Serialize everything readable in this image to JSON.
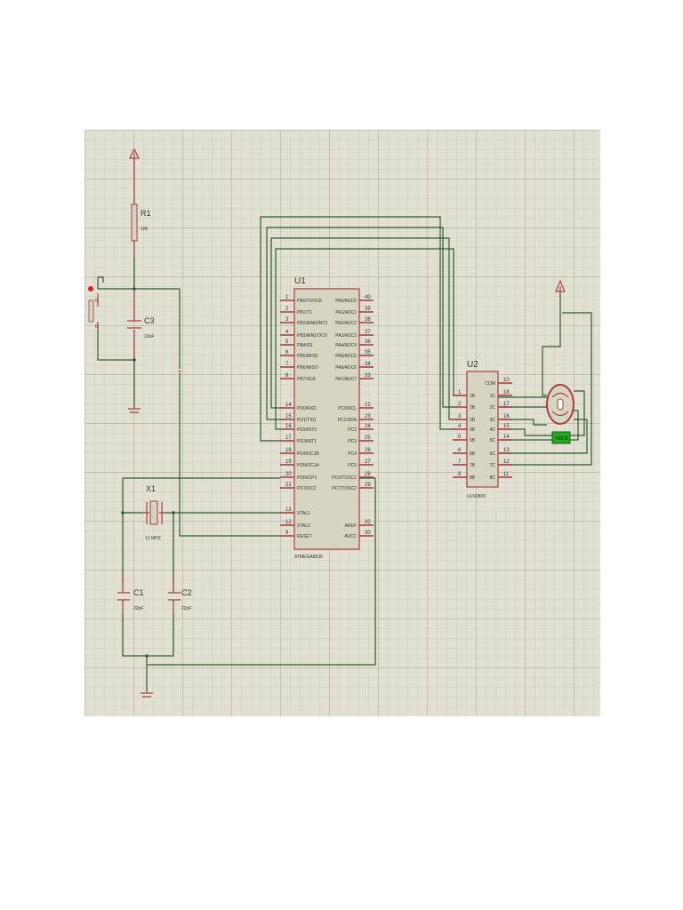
{
  "colors": {
    "grid_bg": "#e2e0d3",
    "wire": "#2f5a2f",
    "component": "#a84040",
    "body": "#d8d4c2"
  },
  "components": {
    "r1": {
      "ref": "R1",
      "value": "10k"
    },
    "c3": {
      "ref": "C3",
      "value": "10uF"
    },
    "x1": {
      "ref": "X1",
      "value": "12 MHZ"
    },
    "c1": {
      "ref": "C1",
      "value": "22pF"
    },
    "c2": {
      "ref": "C2",
      "value": "22pF"
    },
    "switch_contacts": [
      "0",
      "0"
    ],
    "motor_readout": "+88.8"
  },
  "u1": {
    "ref": "U1",
    "part": "ATMEGA8535",
    "left_pins": [
      {
        "num": "1",
        "name": "PB0/T0/XCK"
      },
      {
        "num": "2",
        "name": "PB1/T1"
      },
      {
        "num": "3",
        "name": "PB2/AIN0/INT2"
      },
      {
        "num": "4",
        "name": "PB3/AIN1/OC0"
      },
      {
        "num": "5",
        "name": "PB4/SS"
      },
      {
        "num": "6",
        "name": "PB5/MOSI"
      },
      {
        "num": "7",
        "name": "PB6/MISO"
      },
      {
        "num": "8",
        "name": "PB7/SCK"
      },
      {
        "num": "14",
        "name": "PD0/RXD"
      },
      {
        "num": "15",
        "name": "PD1/TXD"
      },
      {
        "num": "16",
        "name": "PD2/INT0"
      },
      {
        "num": "17",
        "name": "PD3/INT1"
      },
      {
        "num": "18",
        "name": "PD4/OC1B"
      },
      {
        "num": "19",
        "name": "PD5/OC1A"
      },
      {
        "num": "20",
        "name": "PD6/ICP1"
      },
      {
        "num": "21",
        "name": "PD7/OC2"
      },
      {
        "num": "13",
        "name": "XTAL1"
      },
      {
        "num": "12",
        "name": "XTAL2"
      },
      {
        "num": "9",
        "name": "RESET"
      }
    ],
    "right_pins": [
      {
        "num": "40",
        "name": "PA0/ADC0"
      },
      {
        "num": "39",
        "name": "PA1/ADC1"
      },
      {
        "num": "38",
        "name": "PA2/ADC2"
      },
      {
        "num": "37",
        "name": "PA3/ADC3"
      },
      {
        "num": "36",
        "name": "PA4/ADC4"
      },
      {
        "num": "35",
        "name": "PA5/ADC5"
      },
      {
        "num": "34",
        "name": "PA6/ADC6"
      },
      {
        "num": "33",
        "name": "PA7/ADC7"
      },
      {
        "num": "22",
        "name": "PC0/SCL"
      },
      {
        "num": "23",
        "name": "PC1/SDA"
      },
      {
        "num": "24",
        "name": "PC2"
      },
      {
        "num": "25",
        "name": "PC3"
      },
      {
        "num": "26",
        "name": "PC4"
      },
      {
        "num": "27",
        "name": "PC5"
      },
      {
        "num": "28",
        "name": "PC6/TOSC1"
      },
      {
        "num": "29",
        "name": "PC7/TOSC2"
      },
      {
        "num": "32",
        "name": "AREF"
      },
      {
        "num": "30",
        "name": "AVCC"
      }
    ]
  },
  "u2": {
    "ref": "U2",
    "part": "ULN2803",
    "left_pins": [
      {
        "num": "1",
        "name": "1B"
      },
      {
        "num": "2",
        "name": "2B"
      },
      {
        "num": "3",
        "name": "3B"
      },
      {
        "num": "4",
        "name": "4B"
      },
      {
        "num": "5",
        "name": "5B"
      },
      {
        "num": "6",
        "name": "6B"
      },
      {
        "num": "7",
        "name": "7B"
      },
      {
        "num": "8",
        "name": "8B"
      }
    ],
    "right_pins": [
      {
        "num": "10",
        "name": "COM"
      },
      {
        "num": "18",
        "name": "1C"
      },
      {
        "num": "17",
        "name": "2C"
      },
      {
        "num": "16",
        "name": "3C"
      },
      {
        "num": "15",
        "name": "4C"
      },
      {
        "num": "14",
        "name": "5C"
      },
      {
        "num": "13",
        "name": "6C"
      },
      {
        "num": "12",
        "name": "7C"
      },
      {
        "num": "11",
        "name": "8C"
      }
    ]
  }
}
